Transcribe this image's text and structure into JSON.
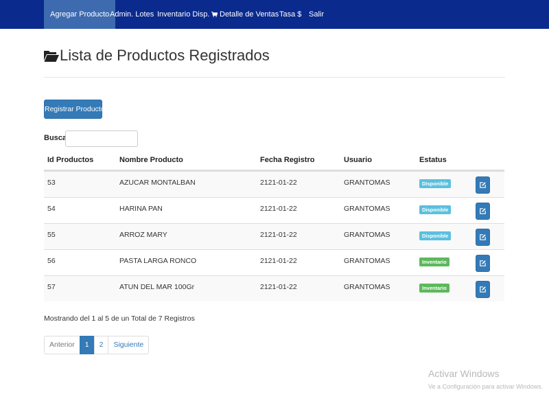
{
  "nav": {
    "items": [
      {
        "label": "Agregar Producto"
      },
      {
        "label": "Admin. Lotes"
      },
      {
        "label": "Inventario Disp."
      },
      {
        "label": "Detalle de Ventas",
        "icon": "cart-icon"
      },
      {
        "label": "Tasa $"
      },
      {
        "label": "Salir"
      }
    ],
    "active_index": 0
  },
  "page": {
    "title": "Lista de Productos Registrados",
    "title_icon": "folder-open-icon",
    "register_button": "Registrar Producto"
  },
  "search": {
    "label": "Buscar:",
    "value": ""
  },
  "table": {
    "headers": [
      "Id Productos",
      "Nombre Producto",
      "Fecha Registro",
      "Usuario",
      "Estatus",
      ""
    ],
    "rows": [
      {
        "id": "53",
        "name": "AZUCAR MONTALBAN",
        "date": "2121-01-22",
        "user": "GRANTOMAS",
        "status": "Disponible",
        "status_color": "#5bc0de"
      },
      {
        "id": "54",
        "name": "HARINA PAN",
        "date": "2121-01-22",
        "user": "GRANTOMAS",
        "status": "Disponible",
        "status_color": "#5bc0de"
      },
      {
        "id": "55",
        "name": "ARROZ MARY",
        "date": "2121-01-22",
        "user": "GRANTOMAS",
        "status": "Disponible",
        "status_color": "#5bc0de"
      },
      {
        "id": "56",
        "name": "PASTA LARGA RONCO",
        "date": "2121-01-22",
        "user": "GRANTOMAS",
        "status": "Inventario",
        "status_color": "#5cb85c"
      },
      {
        "id": "57",
        "name": "ATUN DEL MAR 100Gr",
        "date": "2121-01-22",
        "user": "GRANTOMAS",
        "status": "Inventario",
        "status_color": "#5cb85c"
      }
    ],
    "action_icon": "edit-icon"
  },
  "summary": "Mostrando del 1 al 5 de un Total de 7 Registros",
  "pagination": {
    "previous": "Anterior",
    "pages": [
      "1",
      "2"
    ],
    "current": "1",
    "next": "Siguiente"
  },
  "watermark": {
    "title": "Activar Windows",
    "subtitle": "Ve a Configuración para activar Windows."
  },
  "colors": {
    "navbar": "#0a2a8e",
    "nav_active": "#3e6bb0",
    "primary": "#337ab7",
    "badge_available": "#5bc0de",
    "badge_inventory": "#5cb85c"
  }
}
